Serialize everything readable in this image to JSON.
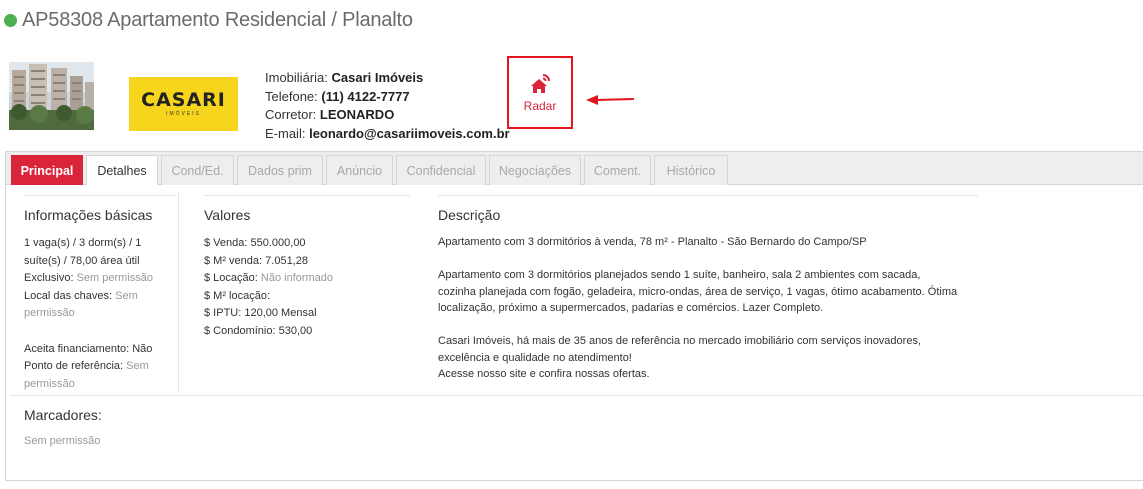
{
  "header": {
    "title": "AP58308 Apartamento Residencial / Planalto",
    "status_color": "#4caf50"
  },
  "logo": {
    "main": "CASARI",
    "sub": "IMÓVEIS"
  },
  "contact": {
    "imobiliaria_label": "Imobiliária:",
    "imobiliaria_value": "Casari Imóveis",
    "telefone_label": "Telefone:",
    "telefone_value": "(11) 4122-7777",
    "corretor_label": "Corretor:",
    "corretor_value": "LEONARDO",
    "email_label": "E-mail:",
    "email_value": "leonardo@casariimoveis.com.br"
  },
  "radar": {
    "label": "Radar",
    "color": "#d9243a"
  },
  "tabs": [
    {
      "label": "Principal"
    },
    {
      "label": "Detalhes"
    },
    {
      "label": "Cond/Ed."
    },
    {
      "label": "Dados prim"
    },
    {
      "label": "Anúncio"
    },
    {
      "label": "Confidencial"
    },
    {
      "label": "Negociações"
    },
    {
      "label": "Coment."
    },
    {
      "label": "Histórico"
    }
  ],
  "basicas": {
    "title": "Informações básicas",
    "line1": "1 vaga(s) / 3 dorm(s) / 1",
    "line2": "suíte(s) / 78,00 área útil",
    "exclusivo_label": "Exclusivo:",
    "exclusivo_value": "Sem permissão",
    "chaves_label": "Local das chaves:",
    "chaves_value_1": "Sem",
    "chaves_value_2": "permissão",
    "financiamento_label": "Aceita financiamento:",
    "financiamento_value": "Não",
    "referencia_label": "Ponto de referência:",
    "referencia_value_1": "Sem",
    "referencia_value_2": "permissão"
  },
  "valores": {
    "title": "Valores",
    "venda_label": "$ Venda:",
    "venda_value": "550.000,00",
    "m2venda_label": "$ M² venda:",
    "m2venda_value": "7.051,28",
    "locacao_label": "$ Locação:",
    "locacao_value": "Não informado",
    "m2locacao_label": "$ M² locação:",
    "iptu_label": "$ IPTU:",
    "iptu_value": "120,00 Mensal",
    "condominio_label": "$ Condomínio:",
    "condominio_value": "530,00"
  },
  "descricao": {
    "title": "Descrição",
    "p1": "Apartamento com 3 dormitórios à venda, 78 m² - Planalto - São Bernardo do Campo/SP",
    "p2_l1": "Apartamento com 3 dormitórios planejados sendo 1 suíte, banheiro, sala 2 ambientes com sacada,",
    "p2_l2": "cozinha planejada com fogão, geladeira, micro-ondas, área de serviço, 1 vagas, ótimo acabamento. Ótima",
    "p2_l3": "localização, próximo a supermercados, padarias e comércios. Lazer Completo.",
    "p3_l1": "Casari Imóveis, há mais de 35 anos de referência no mercado imobiliário com serviços inovadores,",
    "p3_l2": "excelência e qualidade no atendimento!",
    "p3_l3": "Acesse nosso site e confira nossas ofertas."
  },
  "marcadores": {
    "title": "Marcadores:",
    "value": "Sem permissão"
  }
}
